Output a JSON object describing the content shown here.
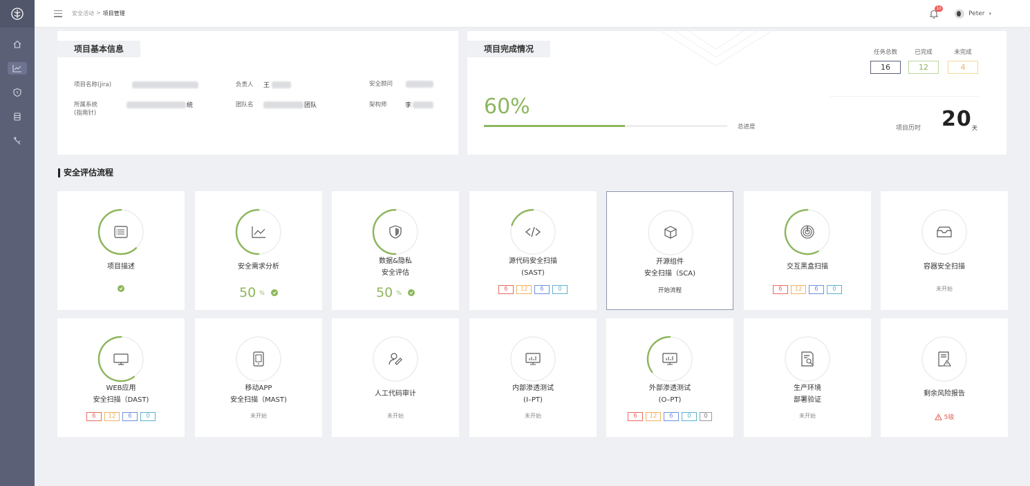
{
  "header": {
    "breadcrumb": [
      "安全活动",
      ">",
      "项目管理"
    ],
    "notification_count": "10",
    "user_name": "Peter",
    "user_caret": "▾"
  },
  "basic_info": {
    "title": "项目基本信息",
    "name_label": "项目名称(jira)",
    "owner_label": "负责人",
    "owner_value": "王",
    "advisor_label": "安全顾问",
    "system_label": "所属系统",
    "system_sub_label": "(指南针)",
    "system_value_tail": "统",
    "team_label": "团队名",
    "team_value_tail": "团队",
    "architect_label": "架构师",
    "architect_value": "李"
  },
  "completion": {
    "title": "项目完成情况",
    "percent_text": "60%",
    "progress": 0.58,
    "progress_caption": "总进度",
    "total_label": "任务总数",
    "done_label": "已完成",
    "undone_label": "未完成",
    "total": "16",
    "done": "12",
    "undone": "4",
    "duration_label": "项目历时",
    "duration_value": "20",
    "duration_unit": "天"
  },
  "process": {
    "title": "安全评估流程",
    "cards": [
      {
        "line1": "项目描述",
        "line2": "",
        "icon": "document-list-icon",
        "ring": 0.62,
        "footer": "check"
      },
      {
        "line1": "安全需求分析",
        "line2": "",
        "icon": "line-chart-icon",
        "ring": 0.5,
        "footer": "percent",
        "percent": "50",
        "unit": "%"
      },
      {
        "line1": "数据&隐私",
        "line2": "安全评估",
        "icon": "shield-icon",
        "ring": 0.5,
        "footer": "percent",
        "percent": "50",
        "unit": "%"
      },
      {
        "line1": "源代码安全扫描",
        "line2": "(SAST)",
        "icon": "code-icon",
        "ring": 0.2,
        "footer": "counts",
        "counts": [
          "6",
          "12",
          "6",
          "0"
        ]
      },
      {
        "line1": "开源组件",
        "line2": "安全扫描（SCA)",
        "icon": "cube-icon",
        "ring": 0,
        "footer": "link",
        "link": "开始流程",
        "selected": true
      },
      {
        "line1": "交互黑盒扫描",
        "line2": "",
        "icon": "radar-icon",
        "ring": 0.58,
        "footer": "counts",
        "counts": [
          "6",
          "12",
          "6",
          "0"
        ]
      },
      {
        "line1": "容器安全扫描",
        "line2": "",
        "icon": "inbox-icon",
        "ring": 0,
        "footer": "status",
        "status": "未开始"
      },
      {
        "line1": "WEB应用",
        "line2": "安全扫描（DAST)",
        "icon": "monitor-icon",
        "ring": 0.6,
        "footer": "counts",
        "counts": [
          "6",
          "12",
          "6",
          "0"
        ]
      },
      {
        "line1": "移动APP",
        "line2": "安全扫描（MAST)",
        "icon": "tablet-icon",
        "ring": 0,
        "footer": "status",
        "status": "未开始"
      },
      {
        "line1": "人工代码审计",
        "line2": "",
        "icon": "user-edit-icon",
        "ring": 0,
        "footer": "status",
        "status": "未开始"
      },
      {
        "line1": "内部渗透测试",
        "line2": "(I–PT)",
        "icon": "screen-chart-icon",
        "ring": 0,
        "footer": "status",
        "status": "未开始"
      },
      {
        "line1": "外部渗透测试",
        "line2": "(O–PT)",
        "icon": "screen-chart-icon",
        "ring": 0.35,
        "footer": "counts",
        "counts": [
          "6",
          "12",
          "6",
          "0",
          "0"
        ]
      },
      {
        "line1": "生产环境",
        "line2": "部署验证",
        "icon": "doc-search-icon",
        "ring": 0,
        "footer": "status",
        "status": "未开始"
      },
      {
        "line1": "剩余风险报告",
        "line2": "",
        "icon": "doc-warning-icon",
        "ring": 0,
        "footer": "risk",
        "risk": "5级"
      }
    ]
  },
  "colors": {
    "accent_green": "#8db65d",
    "sidebar": "#5b6077",
    "count_colors": [
      "#e76a5e",
      "#f0b261",
      "#6f8ee0",
      "#5ab2d0",
      "#999999"
    ]
  }
}
